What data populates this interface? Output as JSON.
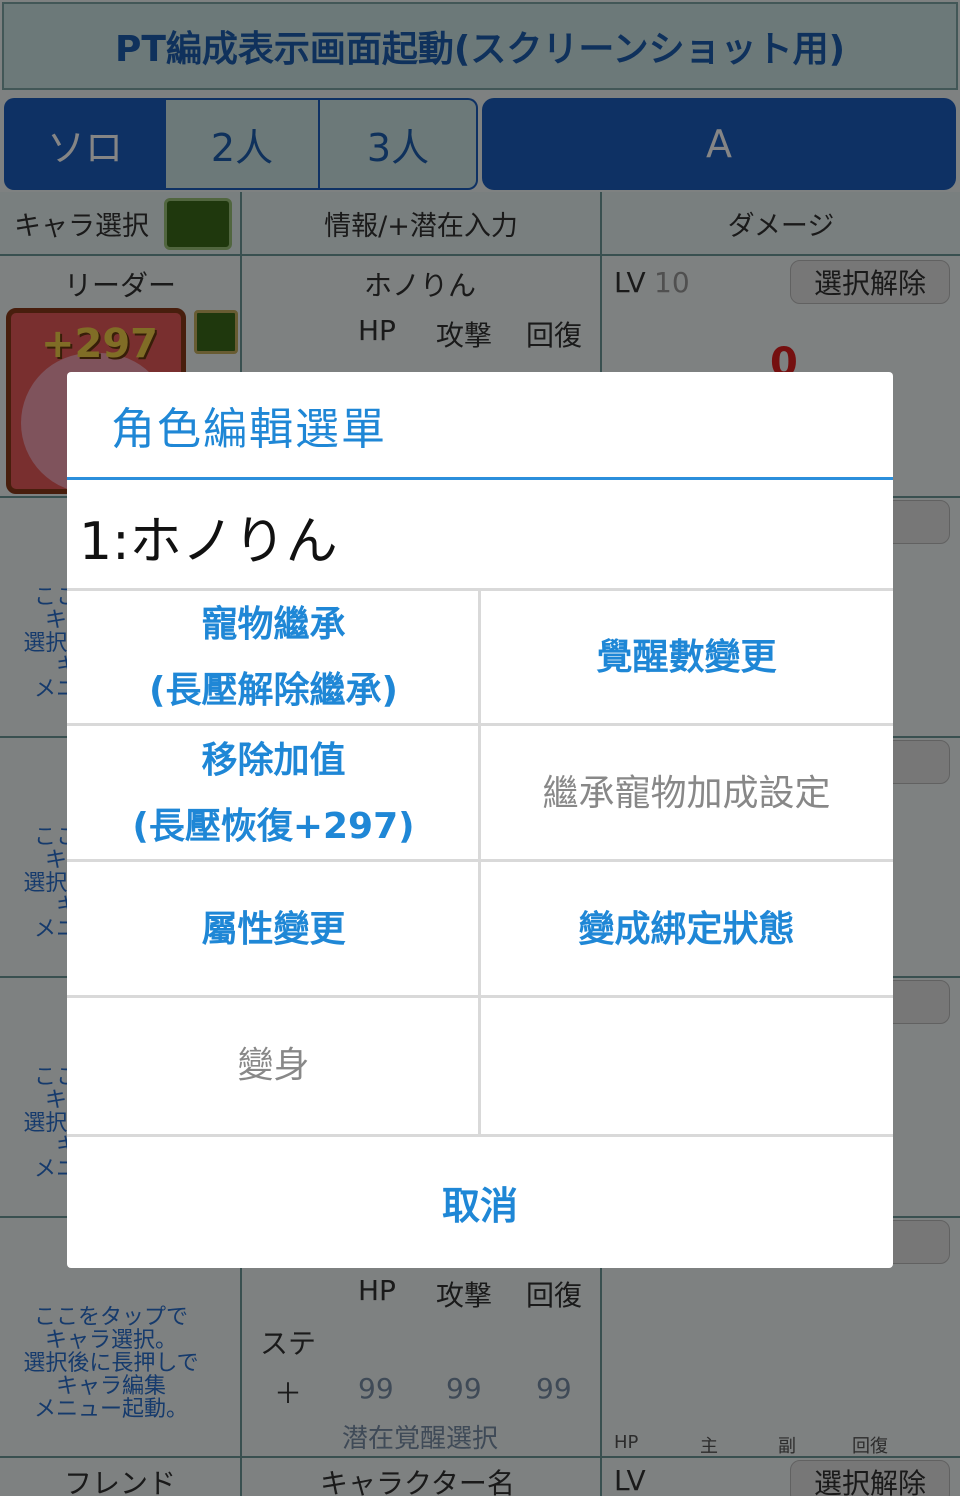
{
  "header": {
    "title": "PT編成表示画面起動(スクリーンショット用)"
  },
  "party_tabs": [
    "ソロ",
    "2人",
    "3人"
  ],
  "team_tab": "A",
  "columns": {
    "char_select": "キャラ選択",
    "info": "情報/+潜在入力",
    "damage": "ダメージ"
  },
  "leader": {
    "label": "リーダー",
    "name": "ホノりん",
    "plus": "+297",
    "stat_headers": [
      "HP",
      "攻撃",
      "回復"
    ],
    "lv_label": "LV",
    "lv_value": "10",
    "deselect": "選択解除",
    "damage": "0"
  },
  "deselect_label": "除",
  "tap_note": "ここをタップで\nキャラ選択。\n選択後に長押しで\nキャラ編集\nメニュー起動。",
  "bottom_slot": {
    "stat_headers": [
      "HP",
      "攻撃",
      "回復"
    ],
    "stat_row_label": "ステ",
    "plus_row_label": "＋",
    "plus_values": [
      "99",
      "99",
      "99"
    ],
    "latent": "潜在覚醒選択",
    "damage_labels": [
      "HP",
      "主",
      "副",
      "回復"
    ]
  },
  "friend_row": {
    "label": "フレンド",
    "name": "キャラクター名",
    "lv_label": "LV",
    "deselect": "選択解除"
  },
  "dialog": {
    "title": "角色編輯選單",
    "character": "1:ホノりん",
    "options": [
      {
        "line1": "寵物繼承",
        "line2": "(長壓解除繼承)",
        "enabled": true
      },
      {
        "line1": "覺醒數變更",
        "line2": "",
        "enabled": true
      },
      {
        "line1": "移除加值",
        "line2": "(長壓恢復+297)",
        "enabled": true
      },
      {
        "line1": "繼承寵物加成設定",
        "line2": "",
        "enabled": false
      },
      {
        "line1": "屬性變更",
        "line2": "",
        "enabled": true
      },
      {
        "line1": "變成綁定狀態",
        "line2": "",
        "enabled": true
      },
      {
        "line1": "變身",
        "line2": "",
        "enabled": false
      },
      {
        "line1": "",
        "line2": "",
        "enabled": false
      }
    ],
    "cancel": "取消"
  }
}
